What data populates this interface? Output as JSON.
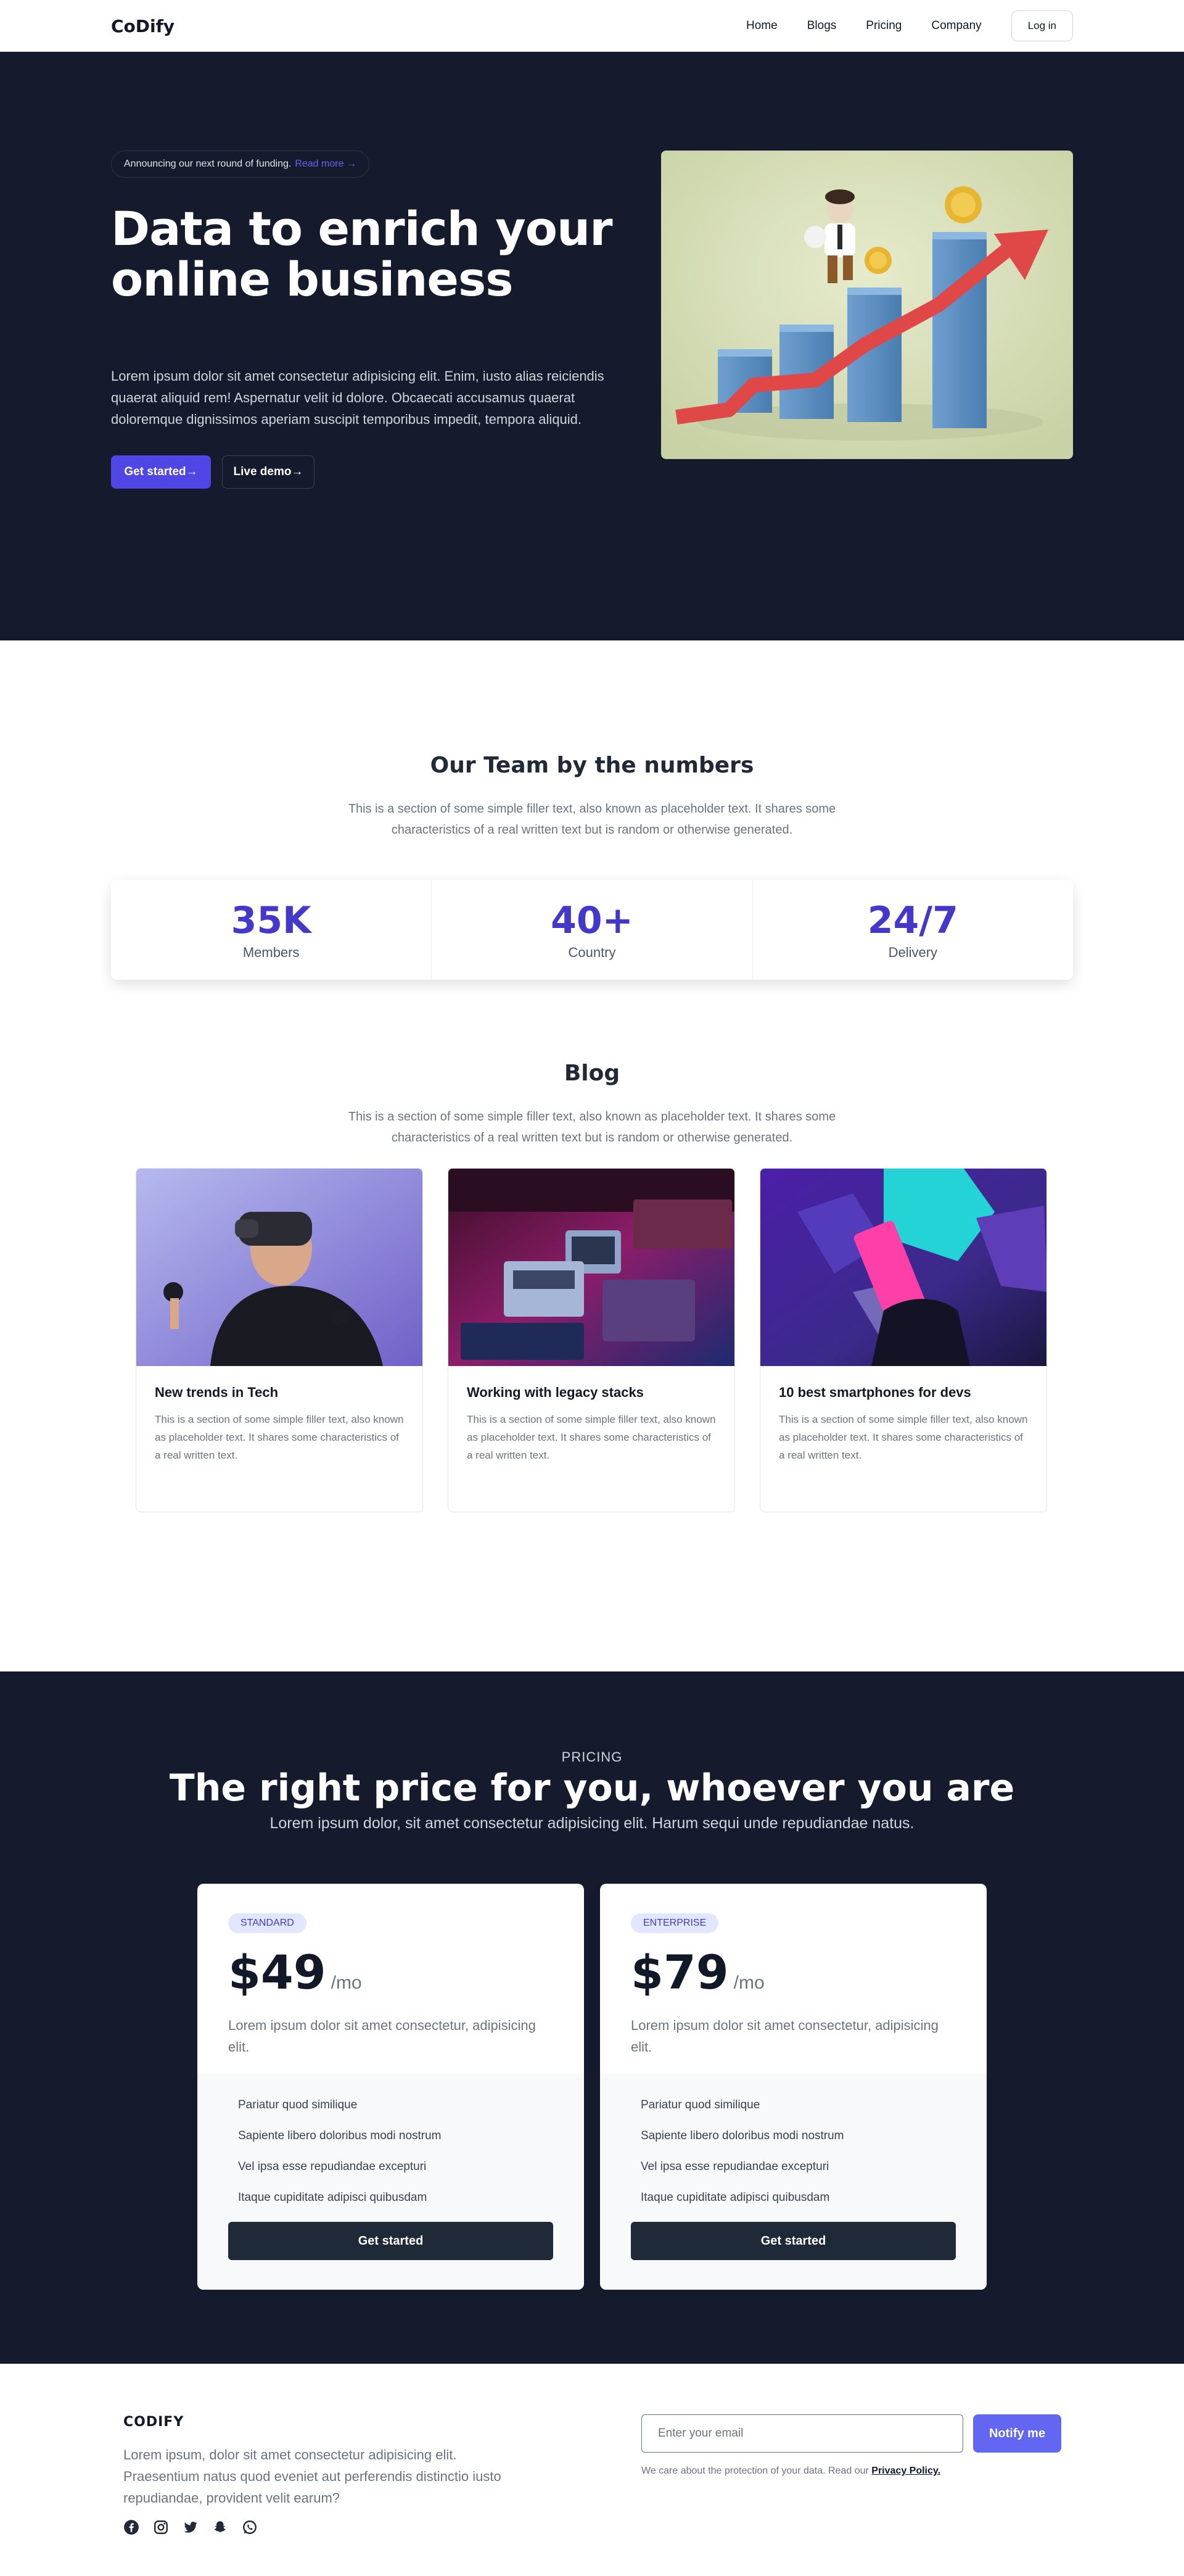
{
  "nav": {
    "logo": "CoDify",
    "links": [
      "Home",
      "Blogs",
      "Pricing",
      "Company"
    ],
    "login": "Log in"
  },
  "hero": {
    "announcement": "Announcing our next round of funding.",
    "read_more": "Read more →",
    "title": "Data to enrich your online business",
    "description": "Lorem ipsum dolor sit amet consectetur adipisicing elit. Enim, iusto alias reiciendis quaerat aliquid rem! Aspernatur velit id dolore. Obcaecati accusamus quaerat doloremque dignissimos aperiam suscipit temporibus impedit, tempora aliquid.",
    "primary_button": "Get started→",
    "secondary_button": "Live demo→"
  },
  "stats": {
    "title": "Our Team by the numbers",
    "subtitle": "This is a section of some simple filler text, also known as placeholder text. It shares some characteristics of a real written text but is random or otherwise generated.",
    "items": [
      {
        "value": "35K",
        "label": "Members"
      },
      {
        "value": "40+",
        "label": "Country"
      },
      {
        "value": "24/7",
        "label": "Delivery"
      }
    ]
  },
  "blog": {
    "title": "Blog",
    "subtitle": "This is a section of some simple filler text, also known as placeholder text. It shares some characteristics of a real written text but is random or otherwise generated.",
    "posts": [
      {
        "title": "New trends in Tech",
        "text": "This is a section of some simple filler text, also known as placeholder text. It shares some characteristics of a real written text."
      },
      {
        "title": "Working with legacy stacks",
        "text": "This is a section of some simple filler text, also known as placeholder text. It shares some characteristics of a real written text."
      },
      {
        "title": "10 best smartphones for devs",
        "text": "This is a section of some simple filler text, also known as placeholder text. It shares some characteristics of a real written text."
      }
    ]
  },
  "pricing": {
    "label": "PRICING",
    "title": "The right price for you, whoever you are",
    "subtitle": "Lorem ipsum dolor, sit amet consectetur adipisicing elit. Harum sequi unde repudiandae natus.",
    "plans": [
      {
        "badge": "STANDARD",
        "price": "$49",
        "period": "/mo",
        "description": "Lorem ipsum dolor sit amet consectetur, adipisicing elit.",
        "features": [
          "Pariatur quod similique",
          "Sapiente libero doloribus modi nostrum",
          "Vel ipsa esse repudiandae excepturi",
          "Itaque cupiditate adipisci quibusdam"
        ],
        "button": "Get started"
      },
      {
        "badge": "ENTERPRISE",
        "price": "$79",
        "period": "/mo",
        "description": "Lorem ipsum dolor sit amet consectetur, adipisicing elit.",
        "features": [
          "Pariatur quod similique",
          "Sapiente libero doloribus modi nostrum",
          "Vel ipsa esse repudiandae excepturi",
          "Itaque cupiditate adipisci quibusdam"
        ],
        "button": "Get started"
      }
    ]
  },
  "footer": {
    "brand": "CODIFY",
    "text": "Lorem ipsum, dolor sit amet consectetur adipisicing elit. Praesentium natus quod eveniet aut perferendis distinctio iusto repudiandae, provident velit earum?",
    "socials": [
      "facebook-icon",
      "instagram-icon",
      "twitter-icon",
      "snapchat-icon",
      "whatsapp-icon"
    ],
    "email_placeholder": "Enter your email",
    "notify_button": "Notify me",
    "privacy_text": "We care about the protection of your data. Read our",
    "privacy_link": "Privacy Policy."
  },
  "colors": {
    "dark_bg": "#151a2c",
    "accent": "#4f46e5",
    "stat_number": "#4338ca",
    "notify": "#6366f1"
  }
}
